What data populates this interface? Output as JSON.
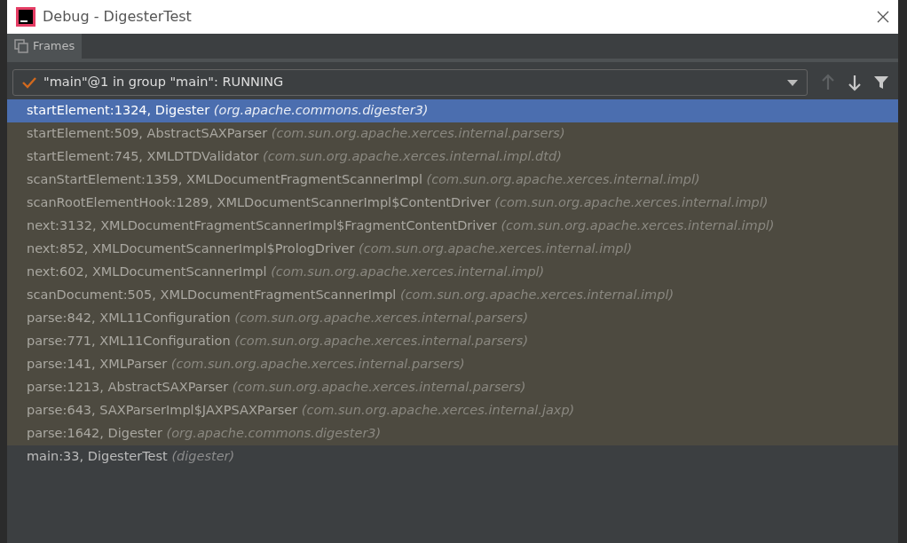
{
  "window": {
    "title": "Debug - DigesterTest"
  },
  "tabs": [
    {
      "label": "Frames",
      "selected": true
    }
  ],
  "thread": {
    "value": "\"main\"@1 in group \"main\": RUNNING"
  },
  "toolbar": [
    {
      "kind": "up",
      "disabled": true
    },
    {
      "kind": "down",
      "disabled": false
    },
    {
      "kind": "filter",
      "disabled": false
    }
  ],
  "frames": [
    {
      "location": "startElement:1324, Digester",
      "package": "(org.apache.commons.digester3)",
      "library": true,
      "selected": true
    },
    {
      "location": "startElement:509, AbstractSAXParser",
      "package": "(com.sun.org.apache.xerces.internal.parsers)",
      "library": true,
      "selected": false
    },
    {
      "location": "startElement:745, XMLDTDValidator",
      "package": "(com.sun.org.apache.xerces.internal.impl.dtd)",
      "library": true,
      "selected": false
    },
    {
      "location": "scanStartElement:1359, XMLDocumentFragmentScannerImpl",
      "package": "(com.sun.org.apache.xerces.internal.impl)",
      "library": true,
      "selected": false
    },
    {
      "location": "scanRootElementHook:1289, XMLDocumentScannerImpl$ContentDriver",
      "package": "(com.sun.org.apache.xerces.internal.impl)",
      "library": true,
      "selected": false
    },
    {
      "location": "next:3132, XMLDocumentFragmentScannerImpl$FragmentContentDriver",
      "package": "(com.sun.org.apache.xerces.internal.impl)",
      "library": true,
      "selected": false
    },
    {
      "location": "next:852, XMLDocumentScannerImpl$PrologDriver",
      "package": "(com.sun.org.apache.xerces.internal.impl)",
      "library": true,
      "selected": false
    },
    {
      "location": "next:602, XMLDocumentScannerImpl",
      "package": "(com.sun.org.apache.xerces.internal.impl)",
      "library": true,
      "selected": false
    },
    {
      "location": "scanDocument:505, XMLDocumentFragmentScannerImpl",
      "package": "(com.sun.org.apache.xerces.internal.impl)",
      "library": true,
      "selected": false
    },
    {
      "location": "parse:842, XML11Configuration",
      "package": "(com.sun.org.apache.xerces.internal.parsers)",
      "library": true,
      "selected": false
    },
    {
      "location": "parse:771, XML11Configuration",
      "package": "(com.sun.org.apache.xerces.internal.parsers)",
      "library": true,
      "selected": false
    },
    {
      "location": "parse:141, XMLParser",
      "package": "(com.sun.org.apache.xerces.internal.parsers)",
      "library": true,
      "selected": false
    },
    {
      "location": "parse:1213, AbstractSAXParser",
      "package": "(com.sun.org.apache.xerces.internal.parsers)",
      "library": true,
      "selected": false
    },
    {
      "location": "parse:643, SAXParserImpl$JAXPSAXParser",
      "package": "(com.sun.org.apache.xerces.internal.jaxp)",
      "library": true,
      "selected": false
    },
    {
      "location": "parse:1642, Digester",
      "package": "(org.apache.commons.digester3)",
      "library": true,
      "selected": false
    },
    {
      "location": "main:33, DigesterTest",
      "package": "(digester)",
      "library": false,
      "selected": false
    }
  ]
}
